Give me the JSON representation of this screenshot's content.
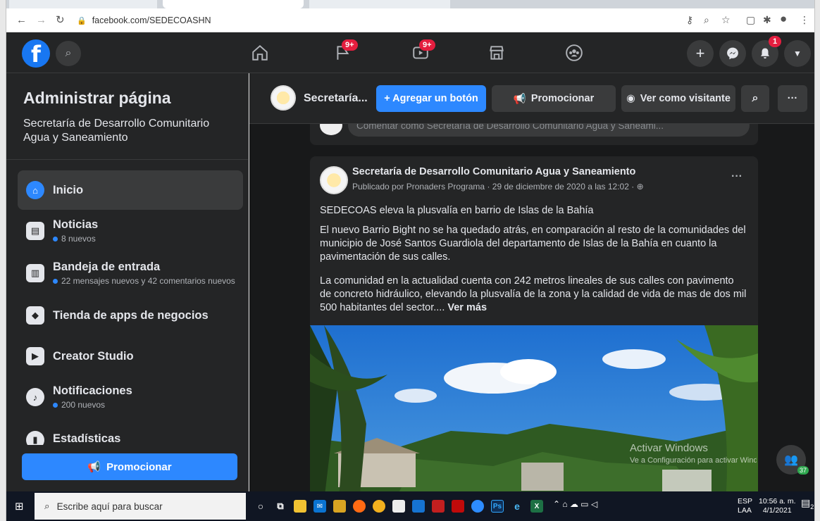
{
  "browser": {
    "url": "facebook.com/SEDECOASHN"
  },
  "topbar": {
    "logo": "f",
    "pages_badge": "9+",
    "watch_badge": "9+",
    "notif_badge": "1"
  },
  "sidebar": {
    "title": "Administrar página",
    "page_name": "Secretaría de Desarrollo Comunitario Agua y Saneamiento",
    "items": [
      {
        "label": "Inicio",
        "sub": ""
      },
      {
        "label": "Noticias",
        "sub": "8 nuevos"
      },
      {
        "label": "Bandeja de entrada",
        "sub": "22 mensajes nuevos y 42 comentarios nuevos"
      },
      {
        "label": "Tienda de apps de negocios",
        "sub": ""
      },
      {
        "label": "Creator Studio",
        "sub": ""
      },
      {
        "label": "Notificaciones",
        "sub": "200 nuevos"
      },
      {
        "label": "Estadísticas",
        "sub": ""
      }
    ],
    "promote_label": "Promocionar"
  },
  "page_header": {
    "name": "Secretaría...",
    "add_button": "+ Agregar un botón",
    "promote": "Promocionar",
    "view_as": "Ver como visitante",
    "more": "···"
  },
  "comment": {
    "placeholder": "Comentar como Secretaría de Desarrollo Comunitario Agua y Saneami..."
  },
  "post": {
    "author": "Secretaría de Desarrollo Comunitario Agua y Saneamiento",
    "meta": "Publicado por Pronaders Programa · 29 de diciembre de 2020 a las 12:02 ·",
    "headline": "SEDECOAS eleva la plusvalía en barrio de Islas de la Bahía",
    "paragraph1": "El nuevo Barrio Bight no se ha quedado atrás, en comparación al resto de la comunidades del municipio de José Santos Guardiola del departamento de Islas de la Bahía en cuanto la pavimentación de sus calles.",
    "paragraph2": "La comunidad en la actualidad cuenta con 242 metros lineales de sus calles con pavimento de concreto hidráulico, elevando la plusvalía de la zona y la calidad de vida de mas de dos mil 500 habitantes del sector....",
    "see_more": "Ver más",
    "more": "···"
  },
  "watermark": {
    "line1": "Activar Windows",
    "line2": "Ve a Configuración para activar Windows."
  },
  "chat_fab_badge": "37",
  "taskbar": {
    "search_placeholder": "Escribe aquí para buscar",
    "lang1": "ESP",
    "lang2": "LAA",
    "time": "10:56 a. m.",
    "date": "4/1/2021",
    "notif_count": "2"
  }
}
